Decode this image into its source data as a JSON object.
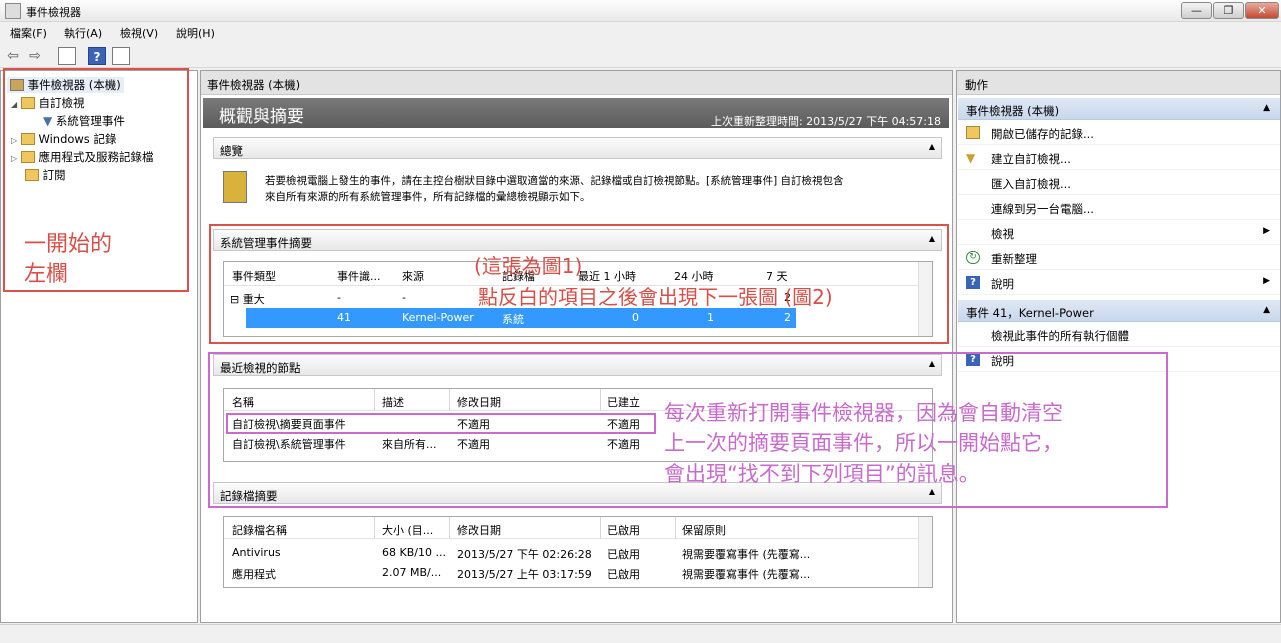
{
  "window": {
    "title": "事件檢視器",
    "buttons": [
      "—",
      "❐",
      "✕"
    ]
  },
  "menu": [
    "檔案(F)",
    "執行(A)",
    "檢視(V)",
    "說明(H)"
  ],
  "tree": {
    "root": "事件檢視器 (本機)",
    "custom_views": "自訂檢視",
    "admin_events": "系統管理事件",
    "windows_logs": "Windows 記錄",
    "app_service_logs": "應用程式及服務記錄檔",
    "subscriptions": "訂閱"
  },
  "center": {
    "header": "事件檢視器 (本機)",
    "page_title": "概觀與摘要",
    "last_refresh": "上次重新整理時間: 2013/5/27 下午 04:57:18",
    "overview": {
      "title": "總覽",
      "text1": "若要檢視電腦上發生的事件，請在主控台樹狀目錄中選取適當的來源、記錄檔或自訂檢視節點。[系統管理事件] 自訂檢視包含",
      "text2": "來自所有來源的所有系統管理事件，所有記錄檔的彙總檢視顯示如下。"
    },
    "admin_summary": {
      "title": "系統管理事件摘要",
      "columns": [
        "事件類型",
        "事件識...",
        "來源",
        "記錄檔",
        "最近 1 小時",
        "24 小時",
        "7 天"
      ],
      "group_label": "⊟ 重大",
      "group_row": [
        "-",
        "-",
        "-",
        "-",
        "2"
      ],
      "selected_row": [
        "41",
        "Kernel-Power",
        "系統",
        "0",
        "1",
        "2"
      ]
    },
    "recent_nodes": {
      "title": "最近檢視的節點",
      "columns": [
        "名稱",
        "描述",
        "修改日期",
        "已建立"
      ],
      "rows": [
        [
          "自訂檢視\\摘要頁面事件",
          "",
          "不適用",
          "不適用"
        ],
        [
          "自訂檢視\\系統管理事件",
          "來自所有...",
          "不適用",
          "不適用"
        ]
      ]
    },
    "log_summary": {
      "title": "記錄檔摘要",
      "columns": [
        "記錄檔名稱",
        "大小 (目...",
        "修改日期",
        "已啟用",
        "保留原則"
      ],
      "rows": [
        [
          "Antivirus",
          "68 KB/10 ...",
          "2013/5/27 下午 02:26:28",
          "已啟用",
          "視需要覆寫事件 (先覆寫..."
        ],
        [
          "應用程式",
          "2.07 MB/...",
          "2013/5/27 上午 03:17:59",
          "已啟用",
          "視需要覆寫事件 (先覆寫..."
        ]
      ]
    }
  },
  "actions": {
    "header": "動作",
    "group1": "事件檢視器 (本機)",
    "items1": [
      "開啟已儲存的記錄...",
      "建立自訂檢視...",
      "匯入自訂檢視...",
      "連線到另一台電腦...",
      "檢視",
      "重新整理",
      "說明"
    ],
    "group2": "事件 41，Kernel-Power",
    "items2": [
      "檢視此事件的所有執行個體",
      "說明"
    ]
  },
  "annotations": {
    "left_line1": "一開始的",
    "left_line2": "左欄",
    "fig1": "(這張為圖1)",
    "fig1_detail": "點反白的項目之後會出現下一張圖 (圖2)",
    "purple1": "每次重新打開事件檢視器，因為會自動清空",
    "purple2": "上一次的摘要頁面事件，所以一開始點它，",
    "purple3": "會出現“找不到下列項目”的訊息。"
  },
  "colors": {
    "selection": "#3399ff",
    "annotation_red": "#d9534a",
    "annotation_purple": "#c86bcc"
  }
}
